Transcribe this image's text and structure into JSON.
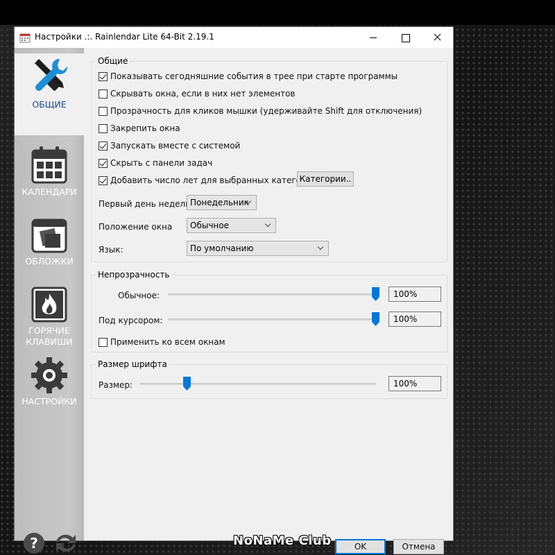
{
  "window": {
    "title": "Настройки .:. Rainlendar Lite 64-Bit 2.19.1"
  },
  "sidebar": {
    "items": [
      {
        "label": "ОБЩИЕ",
        "icon": "tools-icon",
        "active": true
      },
      {
        "label": "КАЛЕНДАРИ",
        "icon": "calendar-icon",
        "active": false
      },
      {
        "label": "ОБЛОЖКИ",
        "icon": "skins-icon",
        "active": false
      },
      {
        "label": "ГОРЯЧИЕ\nКЛАВИШИ",
        "label_line1": "ГОРЯЧИЕ",
        "label_line2": "КЛАВИШИ",
        "icon": "flame-icon",
        "active": false
      },
      {
        "label": "НАСТРОЙКИ",
        "icon": "gear-icon",
        "active": false
      }
    ],
    "footer_icons": [
      "help-icon",
      "sync-icon"
    ]
  },
  "general": {
    "title": "Общие",
    "checkboxes": [
      {
        "label": "Показывать сегодняшние события в трее при старте программы",
        "checked": true
      },
      {
        "label": "Скрывать окна, если в них нет элементов",
        "checked": false
      },
      {
        "label": "Прозрачность для кликов мышки (удерживайте Shift для отключения)",
        "checked": false
      },
      {
        "label": "Закрепить окна",
        "checked": false
      },
      {
        "label": "Запускать вместе с системой",
        "checked": true
      },
      {
        "label": "Скрыть с панели задач",
        "checked": true
      },
      {
        "label": "Добавить число лет для выбранных категорий",
        "checked": true
      }
    ],
    "categories_button": "Категории..",
    "first_day_label": "Первый день недели:",
    "first_day_value": "Понедельник",
    "window_pos_label": "Положение окна",
    "window_pos_value": "Обычное",
    "language_label": "Язык:",
    "language_value": "По умолчанию"
  },
  "opacity": {
    "title": "Непрозрачность",
    "normal_label": "Обычное:",
    "normal_value": "100%",
    "normal_level": 1.0,
    "hover_label": "Под курсором:",
    "hover_value": "100%",
    "hover_level": 1.0,
    "apply_all_label": "Применить ко всем окнам",
    "apply_all_checked": false
  },
  "font": {
    "title": "Размер шрифта",
    "size_label": "Размер:",
    "size_value": "100%",
    "size_level": 0.2
  },
  "buttons": {
    "ok": "OK",
    "cancel": "Отмена"
  },
  "watermark": "NoNaMe Club",
  "colors": {
    "accent": "#0078d7",
    "active_nav_text": "#1a4a8a",
    "sidebar_bg": "#c4c4c4"
  }
}
